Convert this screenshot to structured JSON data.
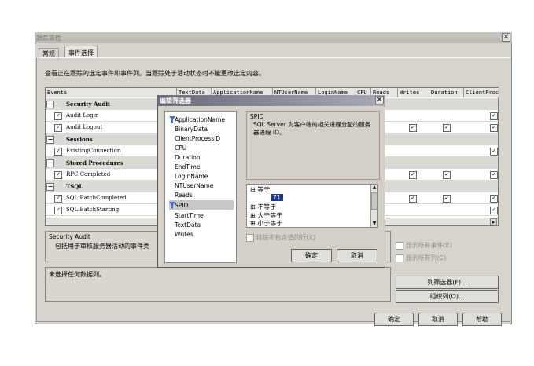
{
  "window": {
    "title": "跟踪属性",
    "close": "×"
  },
  "tabs": [
    {
      "label": "常规"
    },
    {
      "label": "事件选择"
    }
  ],
  "description": "查看正在跟踪的选定事件和事件列。当跟踪处于活动状态时不能更改选定内容。",
  "grid": {
    "columns": [
      {
        "label": "Events"
      },
      {
        "label": "TextData"
      },
      {
        "label": "ApplicationName"
      },
      {
        "label": "NTUserName"
      },
      {
        "label": "LoginName"
      },
      {
        "label": "CPU"
      },
      {
        "label": "Reads"
      },
      {
        "label": "Writes"
      },
      {
        "label": "Duration"
      },
      {
        "label": "ClientProcessID"
      }
    ],
    "rows": [
      {
        "type": "category",
        "label": "Security Audit"
      },
      {
        "type": "event",
        "label": "Audit Login"
      },
      {
        "type": "event",
        "label": "Audit Logout"
      },
      {
        "type": "category",
        "label": "Sessions"
      },
      {
        "type": "event",
        "label": "ExistingConnection"
      },
      {
        "type": "category",
        "label": "Stored Procedures"
      },
      {
        "type": "event",
        "label": "RPC:Completed"
      },
      {
        "type": "category",
        "label": "TSQL"
      },
      {
        "type": "event",
        "label": "SQL:BatchCompleted"
      },
      {
        "type": "event",
        "label": "SQL:BatchStarting"
      }
    ],
    "check": "✓"
  },
  "info_panel": {
    "title": "Security Audit",
    "text": "包括用于审核服务器活动的事件类"
  },
  "status_text": "未选择任何数据列。",
  "options": {
    "show_all_events": "显示所有事件(E)",
    "show_all_columns": "显示所有列(C)"
  },
  "side_buttons": {
    "column_filters": "列筛选器(F)...",
    "organize_columns": "组织列(O)..."
  },
  "bottom_buttons": {
    "ok": "确定",
    "cancel": "取消",
    "help": "帮助"
  },
  "dialog": {
    "title": "编辑筛选器",
    "close": "×",
    "columns": [
      "ApplicationName",
      "BinaryData",
      "ClientProcessID",
      "CPU",
      "Duration",
      "EndTime",
      "LoginName",
      "NTUserName",
      "Reads",
      "SPID",
      "StartTime",
      "TextData",
      "Writes"
    ],
    "selected_column": "SPID",
    "desc_title": "SPID",
    "desc_text": "SQL Server 为客户端的相关进程分配的服务器进程 ID。",
    "tree": [
      {
        "sign": "⊟",
        "label": "等于"
      },
      {
        "sign": "",
        "label": "71"
      },
      {
        "sign": "⊞",
        "label": "不等于"
      },
      {
        "sign": "⊞",
        "label": "大于等于"
      },
      {
        "sign": "⊞",
        "label": "小于等于"
      }
    ],
    "exclude_label": "排除不包含值的行(X)",
    "ok": "确定",
    "cancel": "取消"
  }
}
